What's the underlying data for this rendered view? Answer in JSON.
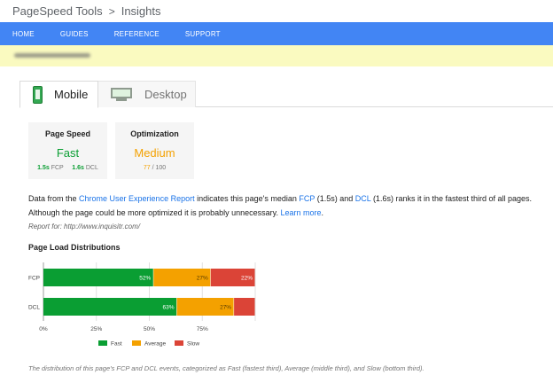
{
  "header": {
    "brand": "PageSpeed Tools",
    "separator": ">",
    "page": "Insights"
  },
  "nav": {
    "items": [
      "HOME",
      "GUIDES",
      "REFERENCE",
      "SUPPORT"
    ]
  },
  "colors": {
    "nav_bg": "#4285f4",
    "url_bar_bg": "#fafac0",
    "fast": "#0a9e33",
    "average": "#f4a100",
    "slow": "#db4437"
  },
  "tabs": {
    "mobile": "Mobile",
    "desktop": "Desktop",
    "mobile_icon": "phone-icon",
    "desktop_icon": "desktop-icon"
  },
  "scores": {
    "speed": {
      "title": "Page Speed",
      "value": "Fast",
      "fcp_value": "1.5s",
      "fcp_label": "FCP",
      "dcl_value": "1.6s",
      "dcl_label": "DCL"
    },
    "optimization": {
      "title": "Optimization",
      "value": "Medium",
      "score": "77",
      "max": "/ 100"
    }
  },
  "summary": {
    "t1": "Data from the ",
    "link_cux": "Chrome User Experience Report",
    "t2": " indicates this page's median ",
    "link_fcp": "FCP",
    "t3": " (1.5s) and ",
    "link_dcl": "DCL",
    "t4": " (1.6s) ranks it in the fastest third of all pages.",
    "t5": "Although the page could be more optimized it is probably unnecessary. ",
    "link_learn": "Learn more",
    "t6": "."
  },
  "report_for": "Report for: http://www.inquisitr.com/",
  "section_title": "Page Load Distributions",
  "chart_data": {
    "type": "bar",
    "orientation": "horizontal",
    "stacked": true,
    "categories": [
      "FCP",
      "DCL"
    ],
    "series": [
      {
        "name": "Fast",
        "values": [
          52,
          63
        ],
        "labels": [
          "52%",
          "63%"
        ]
      },
      {
        "name": "Average",
        "values": [
          27,
          27
        ],
        "labels": [
          "27%",
          "27%"
        ]
      },
      {
        "name": "Slow",
        "values": [
          22,
          10
        ],
        "labels": [
          "22%",
          ""
        ]
      }
    ],
    "xlim": [
      0,
      100
    ],
    "xticks": [
      "0%",
      "25%",
      "50%",
      "75%"
    ],
    "grid": true,
    "legend": "bottom"
  },
  "footer_note": "The distribution of this page's FCP and DCL events, categorized as Fast (fastest third), Average (middle third), and Slow (bottom third)."
}
